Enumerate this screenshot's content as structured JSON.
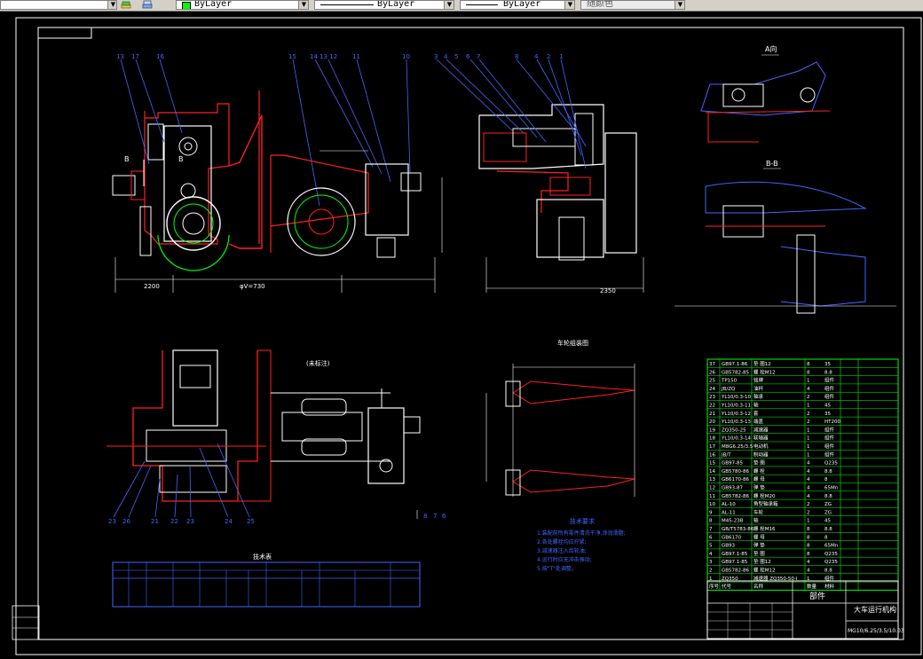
{
  "toolbar": {
    "layer_icons": [
      "layers-icon",
      "layer-states-icon"
    ],
    "color_value": "ByLayer",
    "color_swatch": "#00ff00",
    "linetype_value": "ByLayer",
    "lineweight_value": "ByLayer",
    "plotstyle_value": "随颜色"
  },
  "drawing": {
    "title_block_name": "部件",
    "title_block_title": "大车运行机构",
    "drawing_number": "MG10/6.25/3.5/10.03",
    "view_a_label": "A向",
    "view_b_label": "B-B",
    "view_bottom_left_label": "(未标注)",
    "view_bottom_right_label": "车轮组装图",
    "notes_heading": "技术要求",
    "notes": [
      "1.装配前所有零件清洗干净,涂润滑脂;",
      "2.各处螺栓均应拧紧;",
      "3.减速器注入齿轮油;",
      "4.运行时应无冲击振动;",
      "5.按\"T\"处调整。"
    ],
    "small_table_heading": "技术表",
    "left_stamp": "借(通)用件登记",
    "dimension_center": "φV=730",
    "dimension_left": "2200",
    "dimension_right": "2350"
  },
  "parts_list": {
    "rows": [
      [
        "37",
        "GB97.1-86",
        "垫 圈12",
        "8",
        "35"
      ],
      [
        "26",
        "GB5782-85",
        "螺 栓M12",
        "8",
        "8.8"
      ],
      [
        "25",
        "TP150",
        "铭牌",
        "1",
        "组件"
      ],
      [
        "24",
        "JB/ZQ",
        "油杯",
        "4",
        "组件"
      ],
      [
        "23",
        "YL10/0.3-10",
        "轴承",
        "2",
        "组件"
      ],
      [
        "22",
        "YL10/0.3-11",
        "轴",
        "1",
        "45"
      ],
      [
        "21",
        "YL10/0.3-12",
        "套",
        "2",
        "35"
      ],
      [
        "20",
        "YL10/0.3-13",
        "端盖",
        "2",
        "HT200"
      ],
      [
        "19",
        "ZQ350-25",
        "减速器",
        "1",
        "组件"
      ],
      [
        "18",
        "YL10/0.3-14",
        "联轴器",
        "1",
        "组件"
      ],
      [
        "17",
        "M8G6.25/3.5",
        "电动机",
        "1",
        "组件"
      ],
      [
        "16",
        "JB/T",
        "制动器",
        "1",
        "组件"
      ],
      [
        "15",
        "GB97-85",
        "垫 圈",
        "4",
        "Q235"
      ],
      [
        "14",
        "GB5780-86",
        "螺 栓",
        "4",
        "8.8"
      ],
      [
        "13",
        "GB6170-86",
        "螺 母",
        "4",
        "8"
      ],
      [
        "12",
        "GB93-87",
        "弹 垫",
        "4",
        "65Mn"
      ],
      [
        "11",
        "GB5782-86",
        "螺 栓M20",
        "4",
        "8.8"
      ],
      [
        "10",
        "AL-10",
        "角型轴承箱",
        "2",
        "ZG"
      ],
      [
        "9",
        "AL-11",
        "车轮",
        "2",
        "ZG"
      ],
      [
        "8",
        "M45-23B",
        "轴",
        "1",
        "45"
      ],
      [
        "7",
        "GB/T5783-86",
        "螺 栓M16",
        "8",
        "8.8"
      ],
      [
        "6",
        "GB6170",
        "螺 母",
        "8",
        "8"
      ],
      [
        "5",
        "GB93",
        "弹 垫",
        "8",
        "65Mn"
      ],
      [
        "4",
        "GB97.1-85",
        "垫 圈",
        "8",
        "Q235"
      ],
      [
        "3",
        "GB97.1-85",
        "垫 圈12",
        "4",
        "Q235"
      ],
      [
        "2",
        "GB5782-86",
        "螺 栓M12",
        "4",
        "8.8"
      ],
      [
        "1",
        "ZQ350",
        "减速器 ZQ350-50-I",
        "1",
        "组件"
      ]
    ],
    "header": [
      "序号",
      "代号",
      "名称",
      "数量",
      "材料"
    ]
  }
}
